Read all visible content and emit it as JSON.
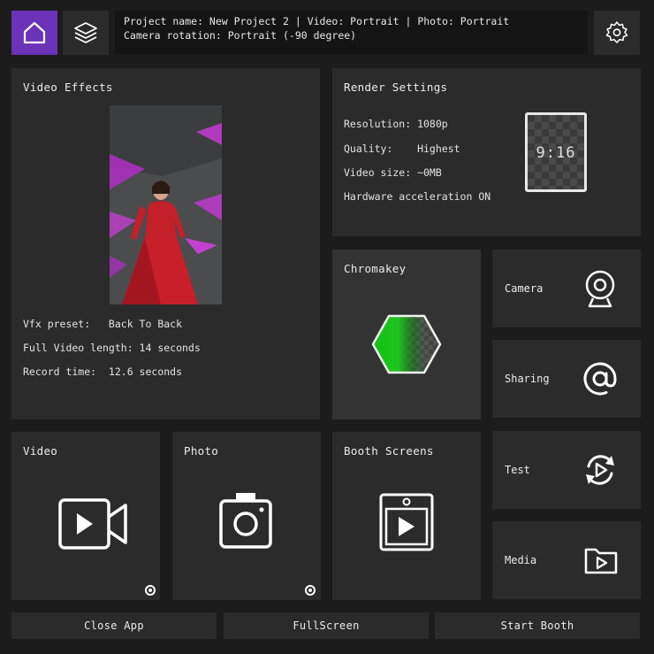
{
  "header": {
    "info_line1": "Project name: New Project 2 | Video: Portrait | Photo: Portrait",
    "info_line2": "Camera rotation: Portrait (-90 degree)",
    "home_icon": "home-icon",
    "layers_icon": "layers-icon",
    "settings_icon": "gear-icon",
    "accent_color": "#6a33b8"
  },
  "video_effects": {
    "title": "Video Effects",
    "preset_label": "Vfx preset:   Back To Back",
    "length_label": "Full Video length: 14 seconds",
    "record_label": "Record time:  12.6 seconds"
  },
  "render_settings": {
    "title": "Render Settings",
    "resolution": "Resolution: 1080p",
    "quality": "Quality:    Highest",
    "video_size": "Video size: ~0MB",
    "hw_accel": "Hardware acceleration ON",
    "aspect_ratio": "9:16"
  },
  "chromakey": {
    "title": "Chromakey",
    "key_color": "#1fc41f"
  },
  "side_tiles": {
    "camera": "Camera",
    "sharing": "Sharing",
    "test": "Test",
    "media": "Media"
  },
  "modes": {
    "video": "Video",
    "photo": "Photo",
    "booth_screens": "Booth Screens"
  },
  "bottom": {
    "close": "Close App",
    "fullscreen": "FullScreen",
    "start": "Start Booth"
  }
}
